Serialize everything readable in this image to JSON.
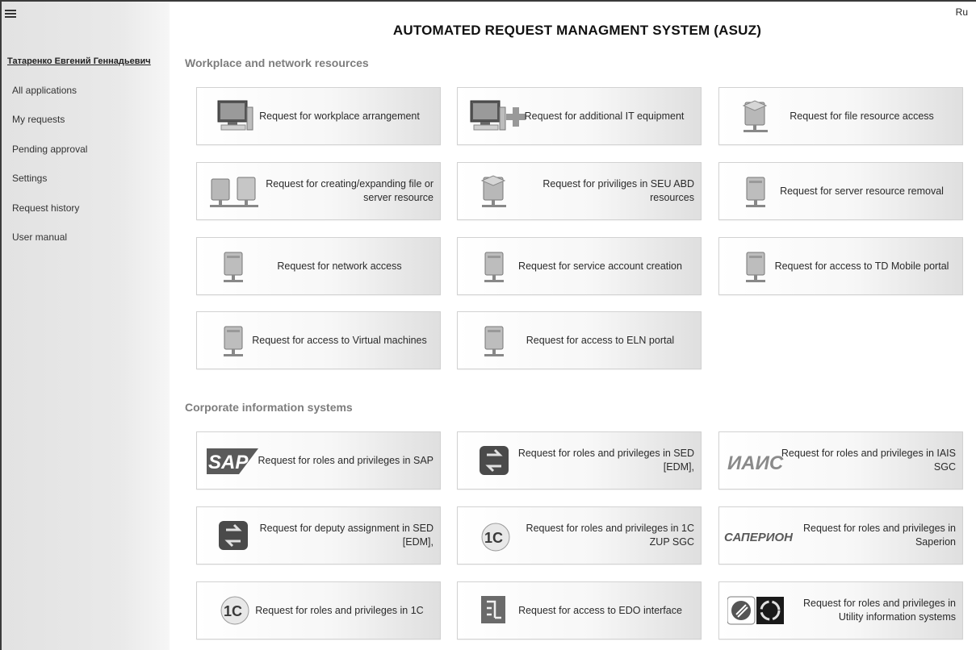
{
  "app": {
    "title": "AUTOMATED REQUEST MANAGMENT SYSTEM (ASUZ)",
    "language": "Ru"
  },
  "sidebar": {
    "user_name": "Татаренко Евгений Геннадьевич",
    "items": [
      {
        "label": "All applications"
      },
      {
        "label": "My requests"
      },
      {
        "label": "Pending approval"
      },
      {
        "label": "Settings"
      },
      {
        "label": "Request history"
      },
      {
        "label": "User manual"
      }
    ]
  },
  "sections": [
    {
      "title": "Workplace and network resources",
      "tiles": [
        {
          "label": "Request for workplace arrangement",
          "icon": "workstation-icon"
        },
        {
          "label": "Request for additional IT equipment",
          "icon": "workstation-add-icon"
        },
        {
          "label": "Request for file resource access",
          "icon": "file-server-icon"
        },
        {
          "label": "Request for creating/expanding file or server resource",
          "icon": "servers-network-icon"
        },
        {
          "label": "Request for priviliges in SEU ABD resources",
          "icon": "file-server-icon"
        },
        {
          "label": "Request for server resource removal",
          "icon": "server-icon"
        },
        {
          "label": "Request for network access",
          "icon": "server-icon"
        },
        {
          "label": "Request for service account creation",
          "icon": "server-icon"
        },
        {
          "label": "Request for access to TD Mobile portal",
          "icon": "server-icon"
        },
        {
          "label": "Request for access to Virtual machines",
          "icon": "server-icon"
        },
        {
          "label": "Request for access to ELN portal",
          "icon": "server-icon"
        }
      ]
    },
    {
      "title": "Corporate information systems",
      "tiles": [
        {
          "label": "Request for roles and privileges in SAP",
          "icon": "sap-logo-icon",
          "logo_text": "SAP"
        },
        {
          "label": "Request for roles and privileges in SED [EDM],",
          "icon": "sed-logo-icon"
        },
        {
          "label": "Request for roles and privileges in IAIS SGC",
          "icon": "iais-logo-icon",
          "logo_text": "ИАИС"
        },
        {
          "label": "Request for deputy assignment in SED [EDM],",
          "icon": "sed-logo-icon"
        },
        {
          "label": "Request for roles and privileges in 1C ZUP SGC",
          "icon": "1c-logo-icon",
          "logo_text": "1С"
        },
        {
          "label": "Request for roles and privileges in Saperion",
          "icon": "saperion-logo-icon",
          "logo_text": "САПЕРИОН"
        },
        {
          "label": "Request for roles and privileges in 1C",
          "icon": "1c-logo-icon",
          "logo_text": "1С"
        },
        {
          "label": "Request for access to EDO interface",
          "icon": "edo-logo-icon"
        },
        {
          "label": "Request for roles and privileges in Utility information systems",
          "icon": "utility-logo-icon"
        }
      ]
    }
  ]
}
